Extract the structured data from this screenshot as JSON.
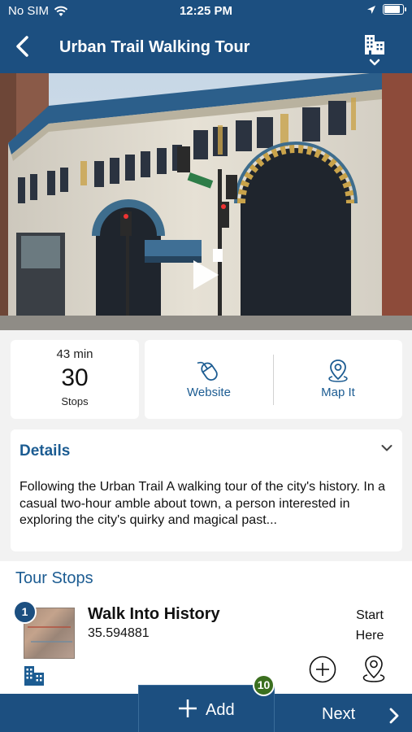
{
  "status_bar": {
    "carrier": "No SIM",
    "time": "12:25 PM",
    "battery_level": 0.9
  },
  "header": {
    "title": "Urban Trail Walking Tour"
  },
  "hero": {
    "play_icon": "play-icon",
    "share_icon": "share-icon"
  },
  "stats": {
    "duration": "43 min",
    "stop_count": "30",
    "stop_unit": "Stops"
  },
  "actions": {
    "website_label": "Website",
    "map_label": "Map It"
  },
  "details": {
    "header": "Details",
    "text": "Following the Urban Trail A walking tour of the city's history. In a casual two-hour amble about town, a person interested in exploring the city's quirky and magical past..."
  },
  "tour_stops": {
    "title": "Tour Stops",
    "items": [
      {
        "number": "1",
        "name": "Walk Into History",
        "coordinate": "35.594881",
        "start_line1": "Start",
        "start_line2": "Here"
      }
    ]
  },
  "bottom_bar": {
    "add_label": "Add",
    "count": "10",
    "next_label": "Next"
  },
  "colors": {
    "brand": "#1c4f80",
    "accent": "#1c5c92",
    "badge_green": "#3b6f1f"
  }
}
